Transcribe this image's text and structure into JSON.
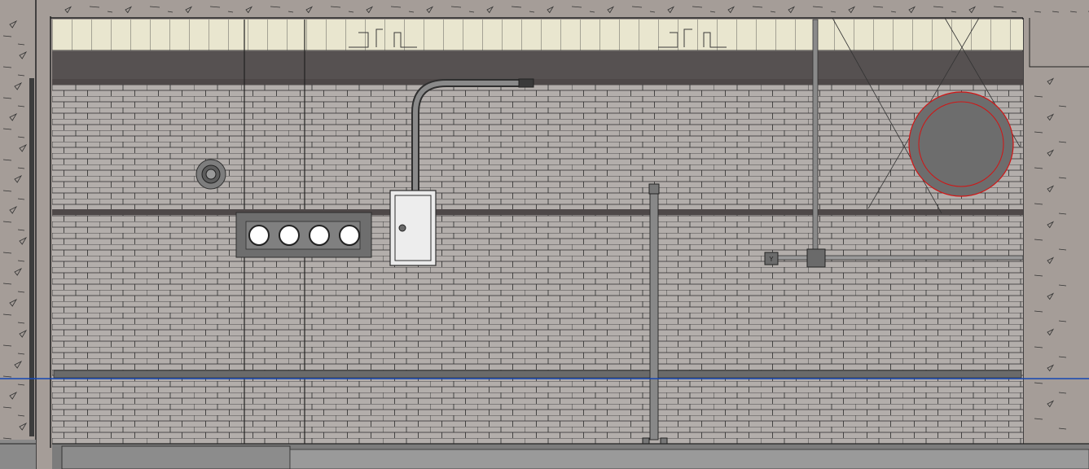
{
  "view": {
    "type": "elevation-view",
    "background_color": "#a59d98"
  },
  "colors": {
    "concrete": "#a59d98",
    "brick_face": "#b3aeab",
    "brick_line": "#2a2a2a",
    "ceiling_band": "#e9e6cf",
    "dark_band": "#565151",
    "ledger_beam": "#4e4848",
    "conduit": "#767676",
    "panel_fill": "#ebebeb",
    "light_fill": "#ffffff",
    "duct_fill": "#6d6d6d",
    "duct_outline": "#d21414",
    "level_line": "#1546b3",
    "floor_slab": "#7c7c7c"
  },
  "icons": {
    "ceiling_diffuser": "grid-diffuser-icon",
    "wall_speaker": "speaker-icon",
    "light_bank": "wall-light-fixture-icon",
    "electrical_panel": "electrical-panel-icon",
    "thermostat": "thermostat-icon",
    "junction_box": "junction-box-icon",
    "round_duct": "round-duct-icon",
    "fire_riser": "pipe-riser-icon"
  },
  "equipment": {
    "light_count": 4
  }
}
